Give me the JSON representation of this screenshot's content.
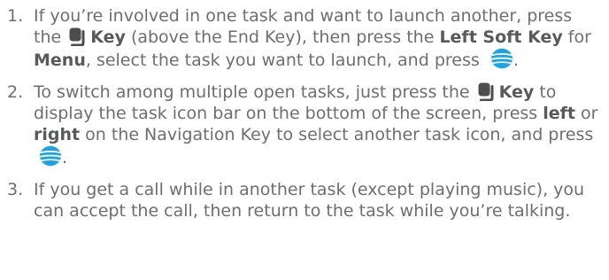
{
  "steps": [
    {
      "number": "1.",
      "parts": [
        {
          "t": "If you’re involved in one task and want to launch another, press the "
        },
        {
          "icon": "multitask-key-icon"
        },
        {
          "t": "Key",
          "bold": true
        },
        {
          "t": " (above the End Key), then press the "
        },
        {
          "t": "Left Soft Key",
          "bold": true
        },
        {
          "t": " for "
        },
        {
          "t": "Menu",
          "bold": true
        },
        {
          "t": ", select the task you want to launch, and press "
        },
        {
          "icon": "att-globe-icon"
        },
        {
          "t": "."
        }
      ]
    },
    {
      "number": "2.",
      "parts": [
        {
          "t": "To switch among multiple open tasks, just press the "
        },
        {
          "icon": "multitask-key-icon"
        },
        {
          "t": "Key",
          "bold": true
        },
        {
          "t": " to display the task icon bar on the bottom of the screen, press "
        },
        {
          "t": "left",
          "bold": true
        },
        {
          "t": " or "
        },
        {
          "t": "right",
          "bold": true
        },
        {
          "t": " on the Navigation Key to select another task icon, and press "
        },
        {
          "icon": "att-globe-icon"
        },
        {
          "t": "."
        }
      ]
    },
    {
      "number": "3.",
      "parts": [
        {
          "t": "If you get a call while in another task (except playing music), you can accept the call, then return to the task while you’re talking."
        }
      ]
    }
  ],
  "colors": {
    "text": "#6d6e71",
    "bold_text": "#58595b",
    "key_icon": "#4d4d4f",
    "globe_blue": "#1aa3e8",
    "globe_stripe": "#ffffff"
  }
}
